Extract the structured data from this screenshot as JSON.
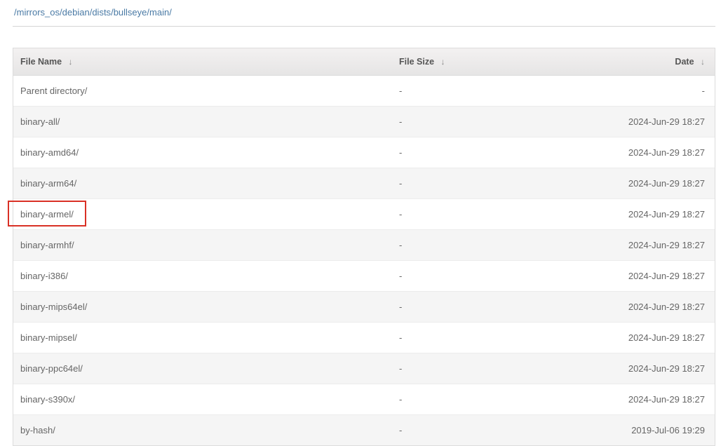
{
  "breadcrumb": {
    "segments": [
      "mirrors_os",
      "debian",
      "dists",
      "bullseye",
      "main"
    ]
  },
  "columns": {
    "name": "File Name",
    "size": "File Size",
    "date": "Date",
    "sort_glyph": "↓"
  },
  "rows": [
    {
      "name": "Parent directory/",
      "size": "-",
      "date": "-"
    },
    {
      "name": "binary-all/",
      "size": "-",
      "date": "2024-Jun-29 18:27"
    },
    {
      "name": "binary-amd64/",
      "size": "-",
      "date": "2024-Jun-29 18:27"
    },
    {
      "name": "binary-arm64/",
      "size": "-",
      "date": "2024-Jun-29 18:27"
    },
    {
      "name": "binary-armel/",
      "size": "-",
      "date": "2024-Jun-29 18:27"
    },
    {
      "name": "binary-armhf/",
      "size": "-",
      "date": "2024-Jun-29 18:27"
    },
    {
      "name": "binary-i386/",
      "size": "-",
      "date": "2024-Jun-29 18:27"
    },
    {
      "name": "binary-mips64el/",
      "size": "-",
      "date": "2024-Jun-29 18:27"
    },
    {
      "name": "binary-mipsel/",
      "size": "-",
      "date": "2024-Jun-29 18:27"
    },
    {
      "name": "binary-ppc64el/",
      "size": "-",
      "date": "2024-Jun-29 18:27"
    },
    {
      "name": "binary-s390x/",
      "size": "-",
      "date": "2024-Jun-29 18:27"
    },
    {
      "name": "by-hash/",
      "size": "-",
      "date": "2019-Jul-06 19:29"
    }
  ],
  "highlight": {
    "row_index": 4
  }
}
